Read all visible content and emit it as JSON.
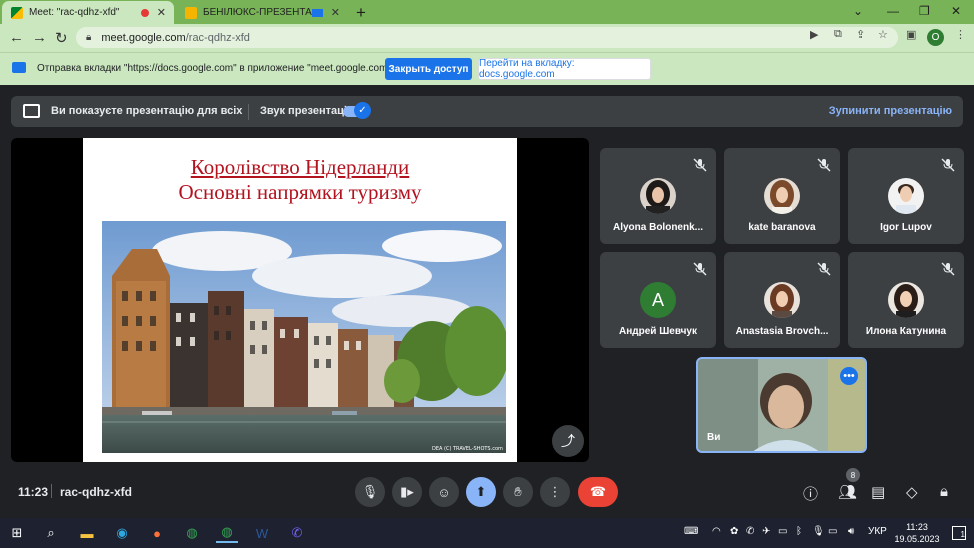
{
  "browser": {
    "tabs": [
      {
        "label": "Meet: \"rac-qdhz-xfd\"",
        "active": true
      },
      {
        "label": "БЕНІЛЮКС-ПРЕЗЕНТА.ppt -",
        "active": false
      }
    ],
    "new_tab": "+",
    "url_domain": "meet.google.com",
    "url_path": "/rac-qdhz-xfd",
    "profile_initial": "O"
  },
  "infobar": {
    "message": "Отправка вкладки \"https://docs.google.com\" в приложение \"meet.google.com\"...",
    "share_button": "Закрыть доступ",
    "goto_button": "Перейти на вкладку: docs.google.com"
  },
  "presenting_bar": {
    "message": "Ви показуєте презентацію для всіх",
    "sound_label": "Звук презентації",
    "sound_enabled": true,
    "stop_label": "Зупинити презентацію"
  },
  "slide": {
    "title": "Королівство Нідерланди",
    "subtitle": "Основні напрямки туризму",
    "photo_caption": "DEA (C) TRAVEL-SHOTS.com"
  },
  "participants": [
    {
      "name": "Alyona Bolonenk...",
      "avatar": "photo",
      "muted": true
    },
    {
      "name": "kate baranova",
      "avatar": "photo",
      "muted": true
    },
    {
      "name": "Igor Lupov",
      "avatar": "photo",
      "muted": true
    },
    {
      "name": "Андрей Шевчук",
      "avatar": "A",
      "avatar_color": "#2e7d32",
      "muted": true
    },
    {
      "name": "Anastasia Brovch...",
      "avatar": "photo",
      "muted": true
    },
    {
      "name": "Илона Катунина",
      "avatar": "photo",
      "muted": true
    }
  ],
  "self": {
    "name": "Ви"
  },
  "meeting": {
    "time": "11:23",
    "code": "rac-qdhz-xfd",
    "participant_count": "8"
  },
  "taskbar": {
    "language": "УКР",
    "time": "11:23",
    "date": "19.05.2023",
    "notifications": "1"
  },
  "colors": {
    "browser_frame": "#78b457",
    "toolbar": "#cbe7bf",
    "meet_bg": "#202124",
    "tile_bg": "#3c4043",
    "accent_blue": "#1a73e8",
    "end_call": "#ea4335",
    "slide_title": "#b3121f"
  }
}
